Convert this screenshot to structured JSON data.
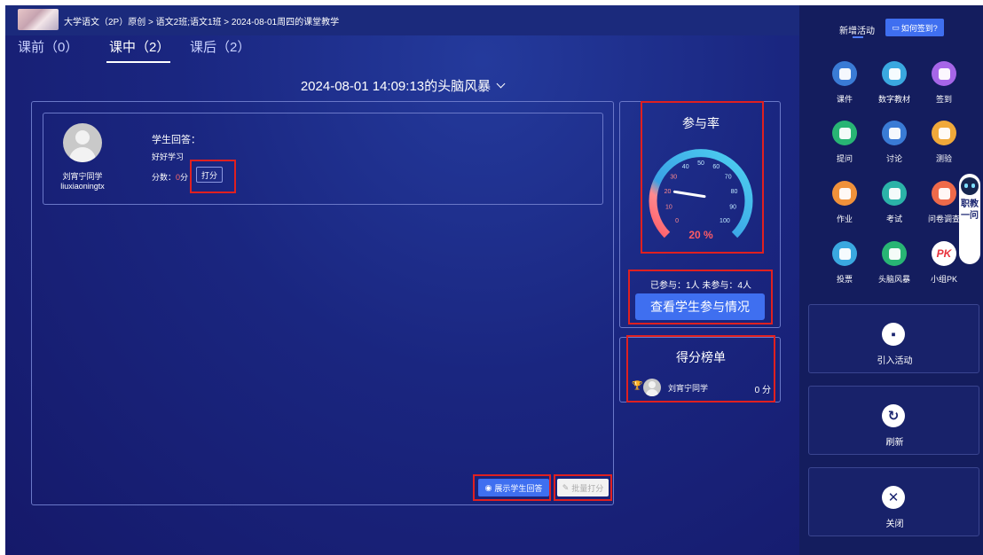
{
  "breadcrumb": "大学语文（2P）原创 > 语文2班;语文1班 > 2024-08-01周四的课堂教学",
  "tabs": [
    {
      "label": "课前（0）",
      "active": false
    },
    {
      "label": "课中（2）",
      "active": true
    },
    {
      "label": "课后（2）",
      "active": false
    }
  ],
  "activity_title": "2024-08-01 14:09:13的头脑风暴",
  "answer": {
    "student_name": "刘宵宁同学",
    "student_id": "liuxiaoningtx",
    "answer_label": "学生回答：",
    "answer_text": "好好学习",
    "score_prefix": "分数：",
    "score_value": "0",
    "score_unit": "分",
    "grade_button": "打分"
  },
  "actions": {
    "show_answers": "展示学生回答",
    "batch_grade": "批量打分"
  },
  "participation": {
    "title": "参与率",
    "rate_text": "20 %",
    "rate_value": 20,
    "gauge_ticks": [
      "0",
      "10",
      "20",
      "30",
      "40",
      "50",
      "60",
      "70",
      "80",
      "90",
      "100"
    ],
    "stats": "已参与：1人   未参与：4人",
    "view_button": "查看学生参与情况"
  },
  "ranking": {
    "title": "得分榜单",
    "rows": [
      {
        "name": "刘宵宁同学",
        "score": "0 分"
      }
    ]
  },
  "sidebar": {
    "header": "新增活动",
    "howto_button": "如何签到?",
    "tools": [
      {
        "label": "课件",
        "color": "#3a7bd5",
        "icon": "courseware-icon"
      },
      {
        "label": "数字教材",
        "color": "#3aa8e0",
        "icon": "textbook-icon"
      },
      {
        "label": "签到",
        "color": "#a666e8",
        "icon": "checkin-icon"
      },
      {
        "label": "提问",
        "color": "#28b574",
        "icon": "question-icon"
      },
      {
        "label": "讨论",
        "color": "#3a7bd5",
        "icon": "discussion-icon"
      },
      {
        "label": "测验",
        "color": "#f0a93a",
        "icon": "quiz-icon"
      },
      {
        "label": "作业",
        "color": "#f0913a",
        "icon": "homework-icon"
      },
      {
        "label": "考试",
        "color": "#2bb3a8",
        "icon": "exam-icon"
      },
      {
        "label": "问卷调查",
        "color": "#ee6a4a",
        "icon": "survey-icon"
      },
      {
        "label": "投票",
        "color": "#3aa8e0",
        "icon": "vote-icon"
      },
      {
        "label": "头脑风暴",
        "color": "#28b574",
        "icon": "brainstorm-icon"
      },
      {
        "label": "小组PK",
        "color": "#ffffff",
        "icon": "group-pk-icon"
      }
    ],
    "import_label": "引入活动",
    "refresh_label": "刷新",
    "close_label": "关闭",
    "assistant_text": "职教一问",
    "pk_text": "PK"
  }
}
